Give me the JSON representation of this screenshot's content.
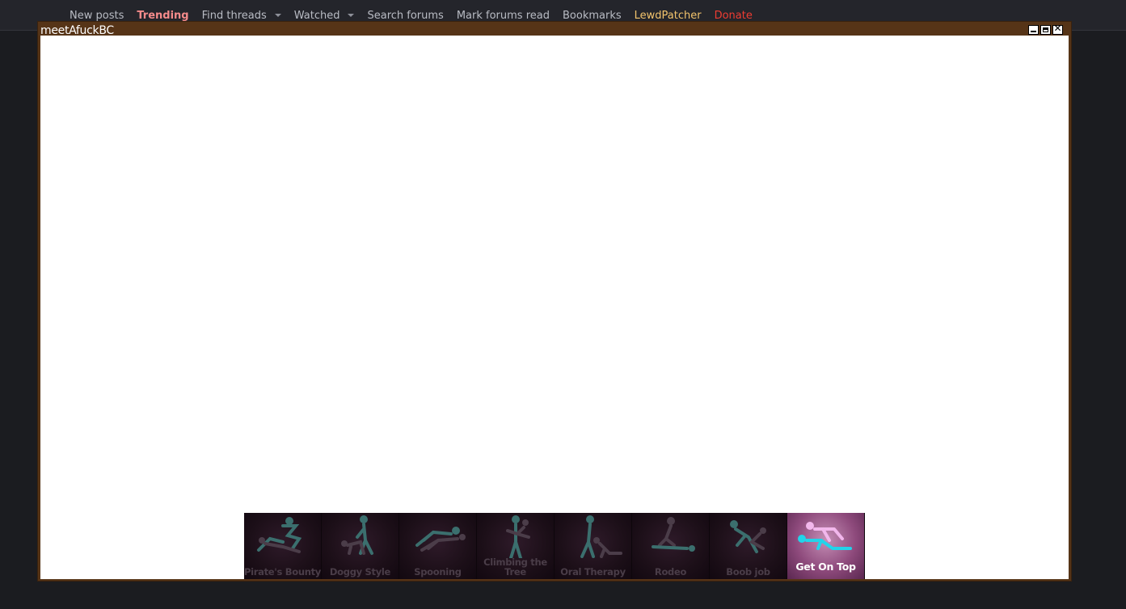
{
  "nav": {
    "items": [
      {
        "label": "New posts",
        "style": "normal"
      },
      {
        "label": "Trending",
        "style": "trending"
      },
      {
        "label": "Find threads",
        "style": "normal",
        "dropdown": true
      },
      {
        "label": "Watched",
        "style": "normal",
        "dropdown": true
      },
      {
        "label": "Search forums",
        "style": "normal"
      },
      {
        "label": "Mark forums read",
        "style": "normal"
      },
      {
        "label": "Bookmarks",
        "style": "normal"
      },
      {
        "label": "LewdPatcher",
        "style": "gold"
      },
      {
        "label": "Donate",
        "style": "red"
      }
    ]
  },
  "popup": {
    "title": "meetAfuckBC",
    "buttons": [
      {
        "name": "minimize-button",
        "icon": "minimize-icon"
      },
      {
        "name": "maximize-button",
        "icon": "maximize-icon"
      },
      {
        "name": "close-button",
        "icon": "close-icon",
        "glyph": "✕"
      }
    ]
  },
  "ad": {
    "tiles": [
      {
        "label": "Pirate's Bounty",
        "icon": "pose-figure-icon"
      },
      {
        "label": "Doggy Style",
        "icon": "pose-figure-icon"
      },
      {
        "label": "Spooning",
        "icon": "pose-figure-icon"
      },
      {
        "label": "Climbing the Tree",
        "icon": "pose-figure-icon"
      },
      {
        "label": "Oral Therapy",
        "icon": "pose-figure-icon"
      },
      {
        "label": "Rodeo",
        "icon": "pose-figure-icon"
      },
      {
        "label": "Boob job",
        "icon": "pose-figure-icon"
      },
      {
        "label": "Get On Top",
        "icon": "pose-figure-icon",
        "active": true
      }
    ]
  },
  "colors": {
    "page_bg": "#1b1c20",
    "nav_bg": "#24252b",
    "popup_frame": "#563417",
    "trending": "#f58b8b",
    "gold": "#f3c46c",
    "donate": "#ef3c32",
    "figure_dim": "#3b6f6e",
    "figure_active_a": "#22d4ea",
    "figure_active_b": "#f2b7ec"
  }
}
